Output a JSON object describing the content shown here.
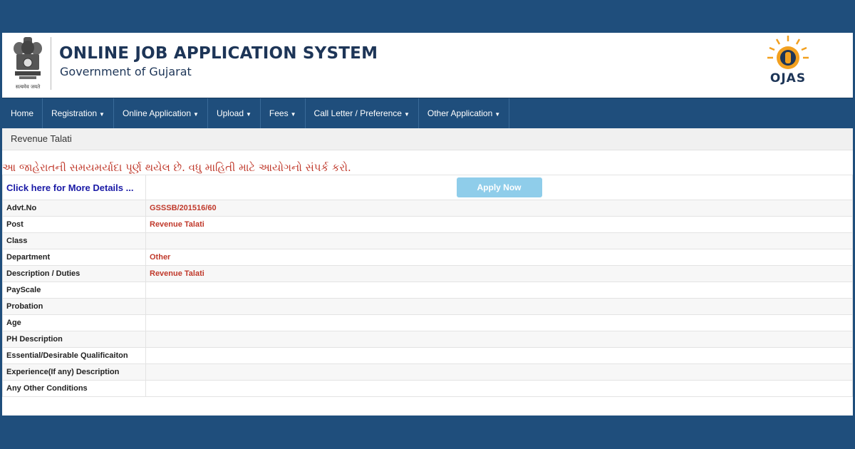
{
  "header": {
    "title": "ONLINE JOB APPLICATION SYSTEM",
    "subtitle": "Government of Gujarat",
    "emblem_caption": "सत्यमेव जयते",
    "logo_text": "OJAS"
  },
  "nav": {
    "items": [
      {
        "label": "Home",
        "has_caret": false
      },
      {
        "label": "Registration",
        "has_caret": true
      },
      {
        "label": "Online Application",
        "has_caret": true
      },
      {
        "label": "Upload",
        "has_caret": true
      },
      {
        "label": "Fees",
        "has_caret": true
      },
      {
        "label": "Call Letter / Preference",
        "has_caret": true
      },
      {
        "label": "Other Application",
        "has_caret": true
      }
    ]
  },
  "breadcrumb": "Revenue Talati",
  "notice": "આ જાહેરાતની સમયમર્યાદા પૂર્ણ થયેલ છે. વધુ માહિતી માટે આયોગનો સંપર્ક કરો.",
  "details_link": "Click here for More Details ...",
  "apply_button": "Apply Now",
  "rows": [
    {
      "label": "Advt.No",
      "value": "GSSSB/201516/60"
    },
    {
      "label": "Post",
      "value": "Revenue Talati"
    },
    {
      "label": "Class",
      "value": ""
    },
    {
      "label": "Department",
      "value": "Other"
    },
    {
      "label": "Description / Duties",
      "value": "Revenue Talati"
    },
    {
      "label": "PayScale",
      "value": ""
    },
    {
      "label": "Probation",
      "value": ""
    },
    {
      "label": "Age",
      "value": ""
    },
    {
      "label": "PH Description",
      "value": ""
    },
    {
      "label": "Essential/Desirable Qualificaiton",
      "value": ""
    },
    {
      "label": "Experience(If any) Description",
      "value": ""
    },
    {
      "label": "Any Other Conditions",
      "value": ""
    }
  ],
  "colors": {
    "navbar": "#1f4e7c",
    "value_text": "#c0392b",
    "apply_button": "#8fcdea",
    "link": "#1a1aa6"
  }
}
